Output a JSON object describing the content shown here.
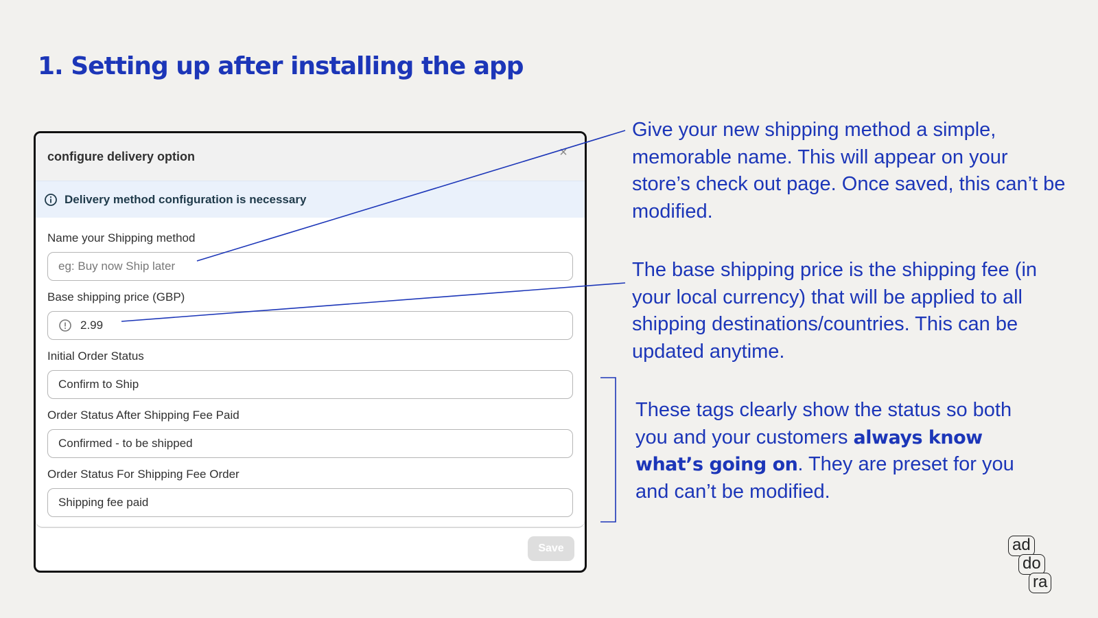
{
  "page": {
    "title": "1. Setting up after installing the app"
  },
  "modal": {
    "title": "configure delivery option",
    "close_icon": "close-icon",
    "banner_icon": "info-circle-icon",
    "banner_text": "Delivery method configuration is necessary",
    "fields": {
      "name_label": "Name your Shipping method",
      "name_placeholder": "eg: Buy now Ship later",
      "price_label": "Base shipping price (GBP)",
      "price_icon": "currency-icon",
      "price_value": "2.99",
      "initial_status_label": "Initial Order Status",
      "initial_status_value": "Confirm to Ship",
      "after_paid_label": "Order Status After Shipping Fee Paid",
      "after_paid_value": "Confirmed - to be shipped",
      "fee_order_label": "Order Status For Shipping Fee Order",
      "fee_order_value": "Shipping fee paid"
    },
    "save_label": "Save"
  },
  "annotations": {
    "name_note": "Give your new shipping method a simple, memorable name. This will appear on your store’s check out page. Once saved, this can’t be modified.",
    "price_note": "The base shipping price is the shipping fee (in your local currency) that will be applied to all shipping destinations/countries. This can be updated anytime.",
    "tags_note_start": "These tags clearly show the status so both you and your customers ",
    "tags_note_bold": "always know what’s going on",
    "tags_note_end": ". They are preset for you and can’t be modified."
  },
  "logo": {
    "line1": "ad",
    "line2": "do",
    "line3": "ra"
  },
  "colors": {
    "accent": "#1c36b8",
    "background": "#f2f1ee",
    "banner": "#eaf1fb"
  }
}
